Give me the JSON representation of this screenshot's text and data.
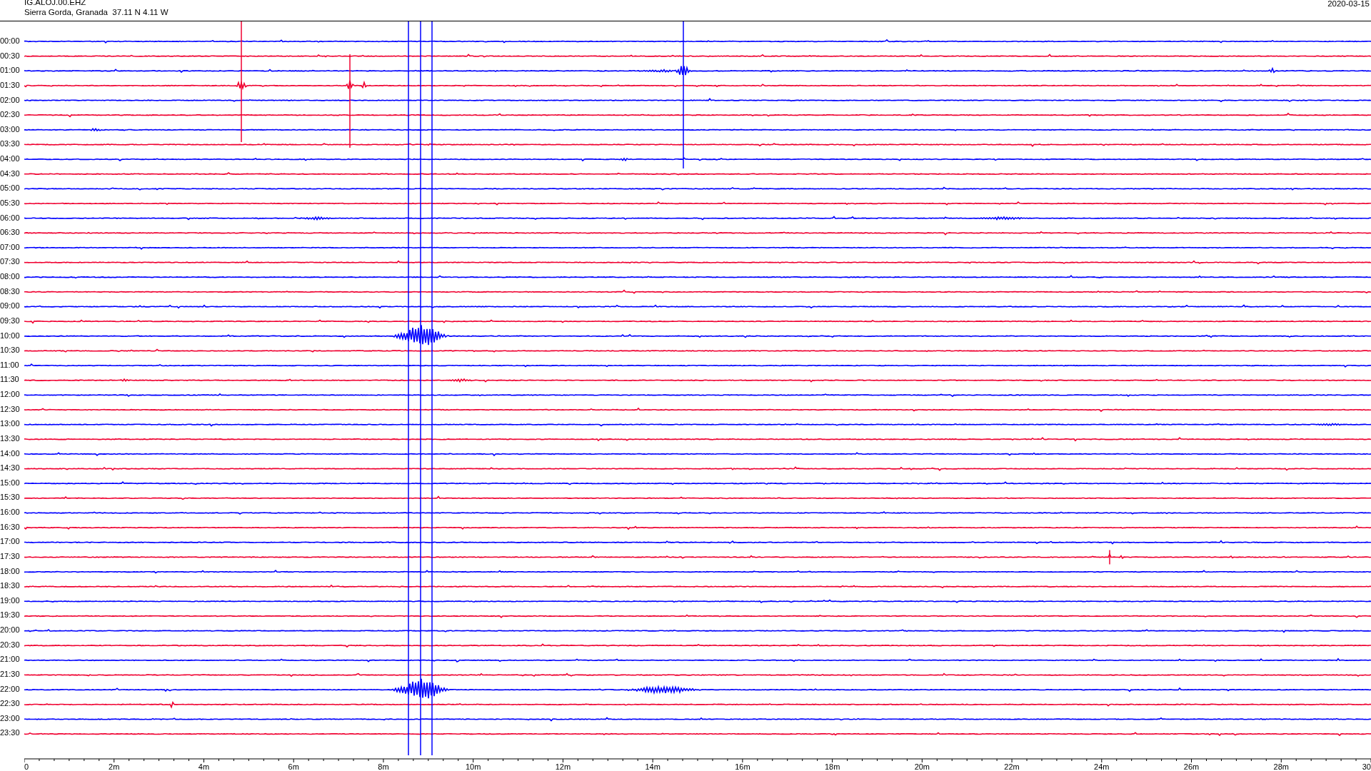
{
  "header": {
    "station": "IG.ALOJ.00.EHZ",
    "location": "Sierra Gorda, Granada  37.11 N 4.11 W",
    "date": "2020-03-15"
  },
  "rows": [
    {
      "time": "00:00",
      "color": "#0000ff"
    },
    {
      "time": "00:30",
      "color": "#f00030"
    },
    {
      "time": "01:00",
      "color": "#0000ff"
    },
    {
      "time": "01:30",
      "color": "#f00030"
    },
    {
      "time": "02:00",
      "color": "#0000ff"
    },
    {
      "time": "02:30",
      "color": "#f00030"
    },
    {
      "time": "03:00",
      "color": "#0000ff"
    },
    {
      "time": "03:30",
      "color": "#f00030"
    },
    {
      "time": "04:00",
      "color": "#0000ff"
    },
    {
      "time": "04:30",
      "color": "#f00030"
    },
    {
      "time": "05:00",
      "color": "#0000ff"
    },
    {
      "time": "05:30",
      "color": "#f00030"
    },
    {
      "time": "06:00",
      "color": "#0000ff"
    },
    {
      "time": "06:30",
      "color": "#f00030"
    },
    {
      "time": "07:00",
      "color": "#0000ff"
    },
    {
      "time": "07:30",
      "color": "#f00030"
    },
    {
      "time": "08:00",
      "color": "#0000ff"
    },
    {
      "time": "08:30",
      "color": "#f00030"
    },
    {
      "time": "09:00",
      "color": "#0000ff"
    },
    {
      "time": "09:30",
      "color": "#f00030"
    },
    {
      "time": "10:00",
      "color": "#0000ff"
    },
    {
      "time": "10:30",
      "color": "#f00030"
    },
    {
      "time": "11:00",
      "color": "#0000ff"
    },
    {
      "time": "11:30",
      "color": "#f00030"
    },
    {
      "time": "12:00",
      "color": "#0000ff"
    },
    {
      "time": "12:30",
      "color": "#f00030"
    },
    {
      "time": "13:00",
      "color": "#0000ff"
    },
    {
      "time": "13:30",
      "color": "#f00030"
    },
    {
      "time": "14:00",
      "color": "#0000ff"
    },
    {
      "time": "14:30",
      "color": "#f00030"
    },
    {
      "time": "15:00",
      "color": "#0000ff"
    },
    {
      "time": "15:30",
      "color": "#f00030"
    },
    {
      "time": "16:00",
      "color": "#0000ff"
    },
    {
      "time": "16:30",
      "color": "#f00030"
    },
    {
      "time": "17:00",
      "color": "#0000ff"
    },
    {
      "time": "17:30",
      "color": "#f00030"
    },
    {
      "time": "18:00",
      "color": "#0000ff"
    },
    {
      "time": "18:30",
      "color": "#f00030"
    },
    {
      "time": "19:00",
      "color": "#0000ff"
    },
    {
      "time": "19:30",
      "color": "#f00030"
    },
    {
      "time": "20:00",
      "color": "#0000ff"
    },
    {
      "time": "20:30",
      "color": "#f00030"
    },
    {
      "time": "21:00",
      "color": "#0000ff"
    },
    {
      "time": "21:30",
      "color": "#f00030"
    },
    {
      "time": "22:00",
      "color": "#0000ff"
    },
    {
      "time": "22:30",
      "color": "#f00030"
    },
    {
      "time": "23:00",
      "color": "#0000ff"
    },
    {
      "time": "23:30",
      "color": "#f00030"
    }
  ],
  "x_axis": {
    "labels": [
      "0",
      "2m",
      "4m",
      "6m",
      "8m",
      "10m",
      "12m",
      "14m",
      "16m",
      "18m",
      "20m",
      "22m",
      "24m",
      "26m",
      "28m",
      "30"
    ]
  }
}
